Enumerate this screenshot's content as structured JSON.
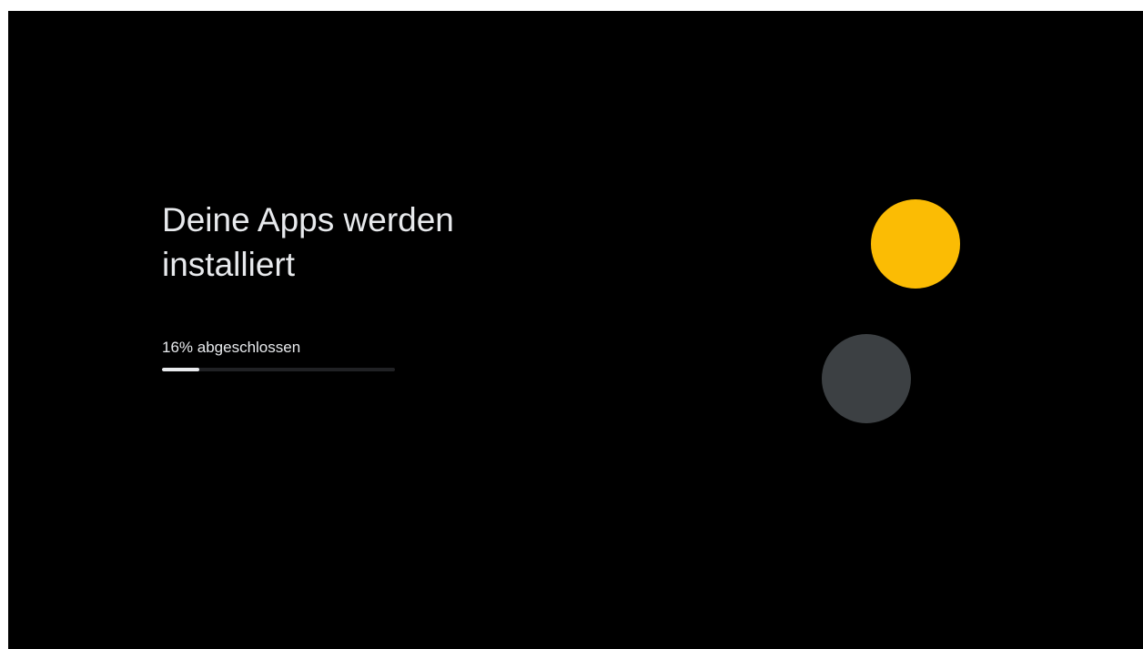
{
  "setup": {
    "title": "Deine Apps werden installiert",
    "progress_label": "16% abgeschlossen",
    "progress_fraction": 0.16
  },
  "colors": {
    "background": "#000000",
    "accent_yellow": "#fbbc04",
    "accent_gray": "#3c4043"
  },
  "decorations": [
    {
      "name": "yellow-circle",
      "color": "#fbbc04"
    },
    {
      "name": "gray-circle",
      "color": "#3c4043"
    }
  ]
}
